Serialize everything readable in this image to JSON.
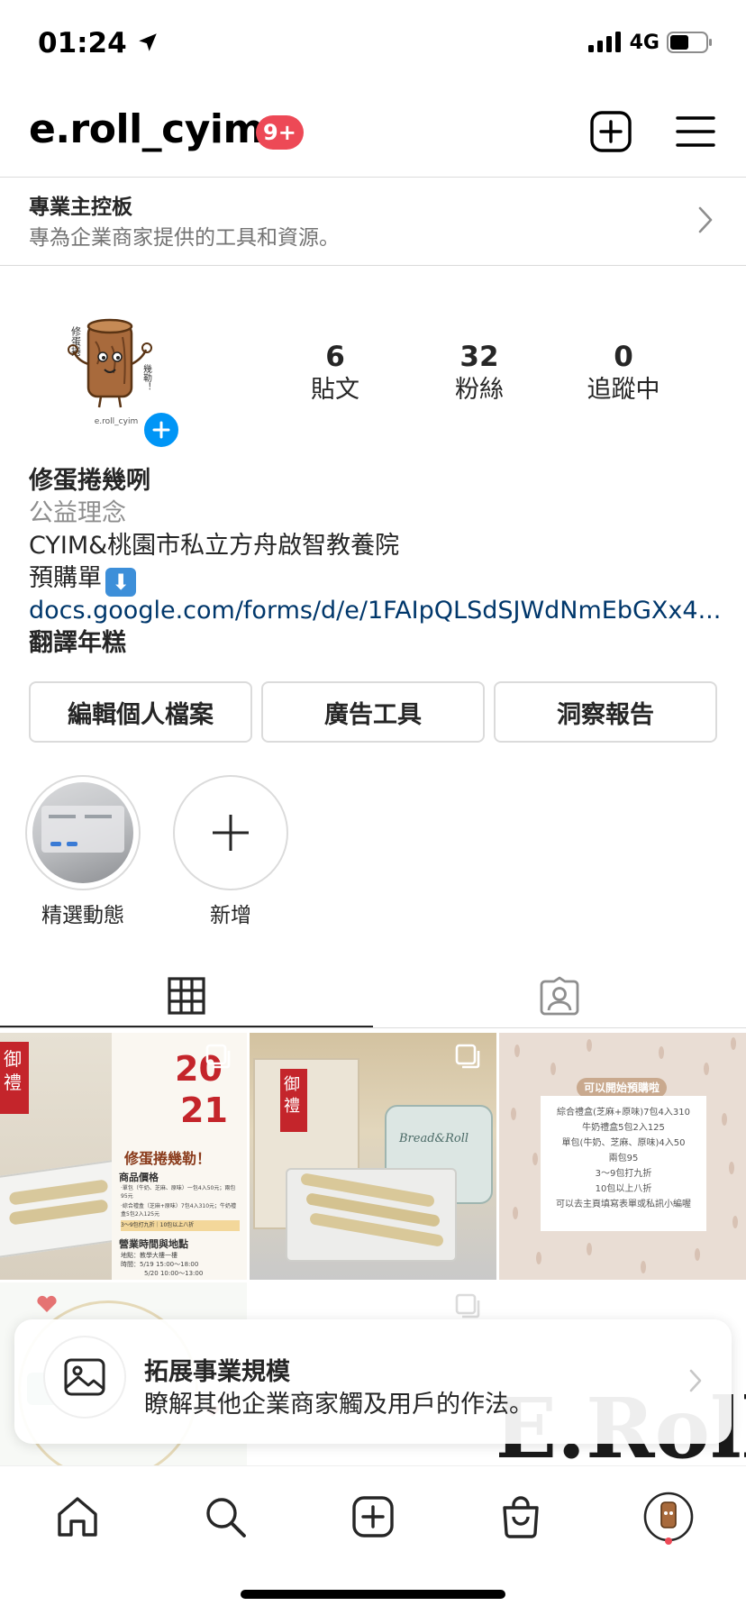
{
  "status_bar": {
    "time": "01:24",
    "network": "4G"
  },
  "header": {
    "username": "e.roll_cyim",
    "notification_badge": "9+"
  },
  "dashboard": {
    "title": "專業主控板",
    "subtitle": "專為企業商家提供的工具和資源。"
  },
  "avatar": {
    "text_vertical": "修蛋捲",
    "text_side": "幾勒！",
    "caption": "e.roll_cyim"
  },
  "stats": [
    {
      "value": "6",
      "label": "貼文"
    },
    {
      "value": "32",
      "label": "粉絲"
    },
    {
      "value": "0",
      "label": "追蹤中"
    }
  ],
  "bio": {
    "name": "修蛋捲幾咧",
    "category": "公益理念",
    "line1": "CYIM&桃園市私立方舟啟智教養院",
    "line2": "預購單",
    "link": "docs.google.com/forms/d/e/1FAIpQLSdSJWdNmEbGXx4...",
    "translate": "翻譯年糕"
  },
  "buttons": {
    "edit_profile": "編輯個人檔案",
    "ad_tools": "廣告工具",
    "insights": "洞察報告"
  },
  "highlights": [
    {
      "label": "精選動態"
    },
    {
      "label": "新增"
    }
  ],
  "posts": {
    "post1": {
      "gift_label": "御禮",
      "big_digits_1": "20",
      "big_digits_2": "21",
      "heading": "修蛋捲幾勒！",
      "section1": "商品價格",
      "price1": "‧單包（牛奶、芝麻、原味）一包4入50元；兩包95元",
      "price2": "‧綜合禮盒（芝麻+原味）7包4入310元；牛奶禮盒5包2入125元",
      "discount": "3～9包打九折｜10包以上八折",
      "section2": "營業時間與地點",
      "location": "地點：教學大樓一樓",
      "time1": "時間：5/19 15:00～18:00",
      "time2": "5/20 10:00～13:00"
    },
    "post2": {
      "gift_label": "御禮",
      "box_script": "Bread&Roll"
    },
    "post3": {
      "header": "可以開始預購啦",
      "lines": [
        "綜合禮盒(芝麻+原味)7包4入310",
        "牛奶禮盒5包2入125",
        "單包(牛奶、芝麻、原味)4入50",
        "兩包95",
        "3～9包打九折",
        "10包以上八折",
        "可以去主頁填寫表單或私訊小編喔"
      ]
    },
    "post6": {
      "logo_text": "E.Roll"
    }
  },
  "banner": {
    "title": "拓展事業規模",
    "subtitle": "瞭解其他企業商家觸及用戶的作法。"
  },
  "colors": {
    "accent_blue": "#0095f6",
    "badge_red": "#ed4956",
    "link": "#00376b",
    "text": "#262626",
    "muted": "#8e8e8e"
  }
}
